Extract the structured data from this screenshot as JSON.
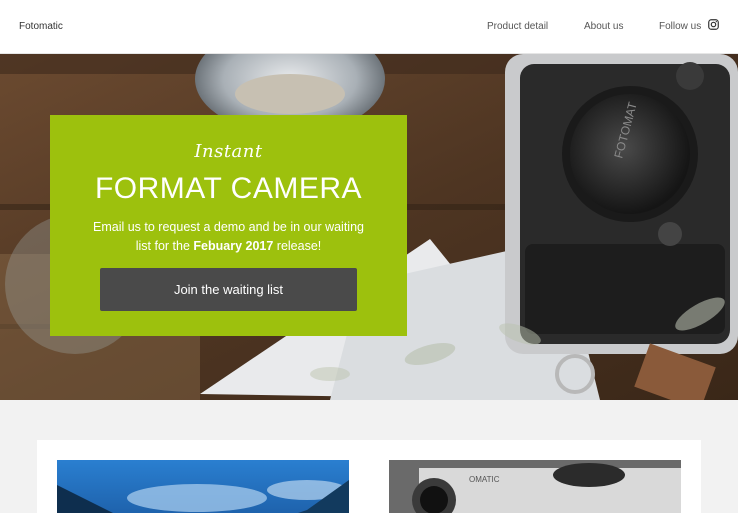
{
  "header": {
    "brand": "Fotomatic",
    "nav": [
      {
        "label": "Product detail"
      },
      {
        "label": "About us"
      },
      {
        "label": "Follow us"
      }
    ],
    "follow_icon": "instagram-icon"
  },
  "hero": {
    "script_text": "Instant",
    "title": "FORMAT CAMERA",
    "text_before": "Email us to request a demo and be in our waiting list for the ",
    "text_bold": "Febuary 2017",
    "text_after": " release!",
    "button_label": "Join the waiting list",
    "accent_color": "#9dc10d",
    "button_color": "#4a4a4a",
    "camera_lens_cap_text": "FOTOMAT"
  },
  "cards": {
    "thumbnails": [
      {
        "subject": "blue sky photo"
      },
      {
        "subject": "camera photo",
        "visible_text": "OMATIC"
      }
    ]
  }
}
